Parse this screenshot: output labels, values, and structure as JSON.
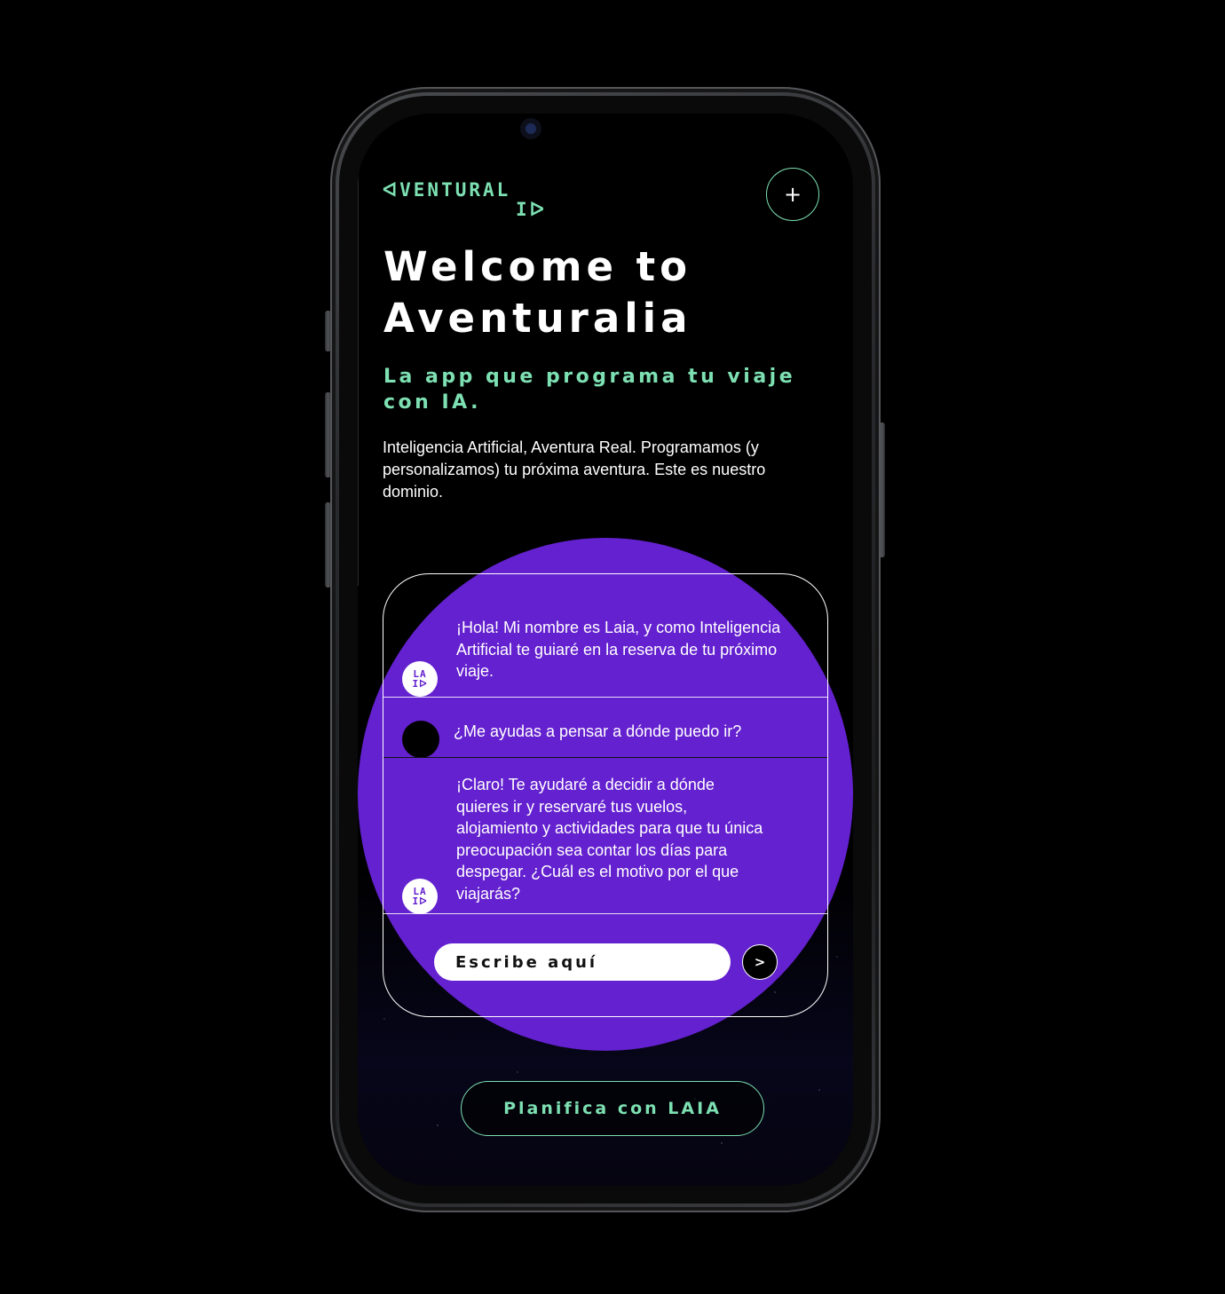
{
  "device": {
    "frame_color": "#2a2b2e"
  },
  "colors": {
    "accent": "#7de0b2",
    "brand_purple": "#6421cf",
    "background": "#000000",
    "text": "#ffffff"
  },
  "header": {
    "logo_line1": "ᐊVENTURAL",
    "logo_line2": "IᐅI",
    "logo_line2_text": "Iᐅ",
    "menu_icon": "plus-icon",
    "menu_symbol": "+"
  },
  "hero": {
    "title": "Welcome to Aventuralia",
    "subtitle": "La app que programa tu viaje con IA.",
    "description": "Inteligencia Artificial, Aventura Real. Programamos (y personalizamos) tu próxima aventura. Este es nuestro dominio."
  },
  "chat": {
    "messages": [
      {
        "sender": "laia",
        "avatar_line1": "LA",
        "avatar_line2": "Iᐅ",
        "text": "¡Hola! Mi nombre es Laia, y como Inteligencia Artificial te guiaré en la reserva de tu próximo viaje."
      },
      {
        "sender": "user",
        "text": "¿Me ayudas a pensar a dónde puedo ir?"
      },
      {
        "sender": "laia",
        "avatar_line1": "LA",
        "avatar_line2": "Iᐅ",
        "text": "¡Claro! Te ayudaré a decidir a dónde quieres ir y reservaré tus vuelos, alojamiento y actividades para que tu única preocupación sea contar los días para despegar. ¿Cuál es el motivo por el que viajarás?"
      }
    ],
    "input_placeholder": "Escribe aquí",
    "send_label": ">"
  },
  "cta": {
    "label": "Planifica con LAIA"
  }
}
